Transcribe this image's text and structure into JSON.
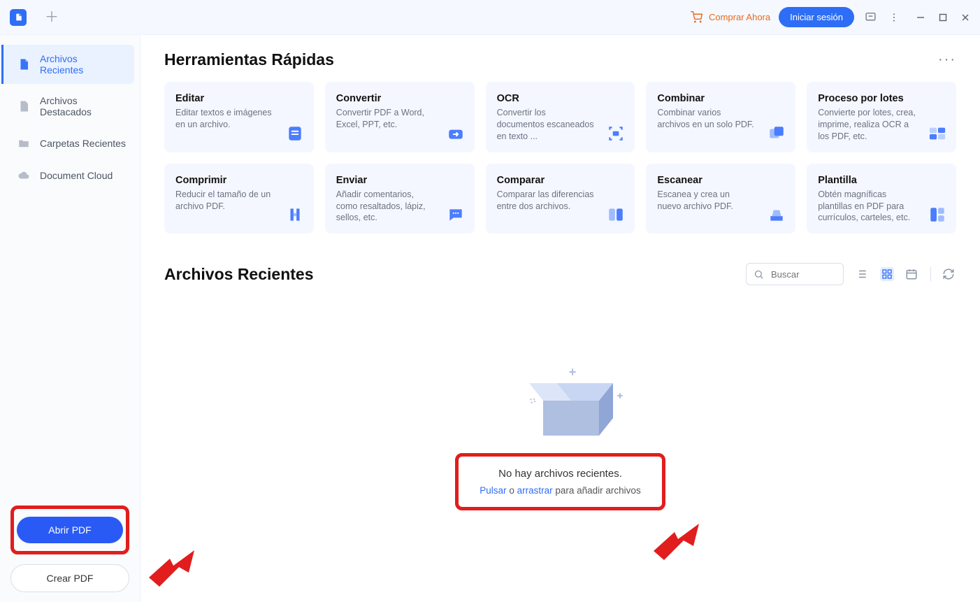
{
  "topbar": {
    "buy_now": "Comprar Ahora",
    "login": "Iniciar sesión"
  },
  "sidebar": {
    "items": [
      {
        "label": "Archivos Recientes"
      },
      {
        "label": "Archivos Destacados"
      },
      {
        "label": "Carpetas Recientes"
      },
      {
        "label": "Document Cloud"
      }
    ],
    "open_pdf": "Abrir PDF",
    "create_pdf": "Crear PDF"
  },
  "quicktools": {
    "title": "Herramientas Rápidas",
    "more": "···",
    "cards": [
      {
        "title": "Editar",
        "desc": "Editar textos e imágenes en un archivo."
      },
      {
        "title": "Convertir",
        "desc": "Convertir PDF a Word, Excel, PPT, etc."
      },
      {
        "title": "OCR",
        "desc": "Convertir los documentos escaneados en texto ..."
      },
      {
        "title": "Combinar",
        "desc": "Combinar varios archivos en un solo PDF."
      },
      {
        "title": "Proceso por lotes",
        "desc": "Convierte por lotes, crea, imprime, realiza OCR a los PDF, etc."
      },
      {
        "title": "Comprimir",
        "desc": "Reducir el tamaño de un archivo PDF."
      },
      {
        "title": "Enviar",
        "desc": "Añadir comentarios, como resaltados, lápiz, sellos, etc."
      },
      {
        "title": "Comparar",
        "desc": "Comparar las diferencias entre dos archivos."
      },
      {
        "title": "Escanear",
        "desc": "Escanea y crea un nuevo archivo PDF."
      },
      {
        "title": "Plantilla",
        "desc": "Obtén magníficas plantillas en PDF para currículos, carteles, etc."
      }
    ]
  },
  "recent": {
    "title": "Archivos Recientes",
    "search_placeholder": "Buscar",
    "empty_title": "No hay archivos recientes.",
    "empty_click": "Pulsar",
    "empty_or": "o",
    "empty_drag": "arrastrar",
    "empty_suffix": "para añadir archivos"
  }
}
